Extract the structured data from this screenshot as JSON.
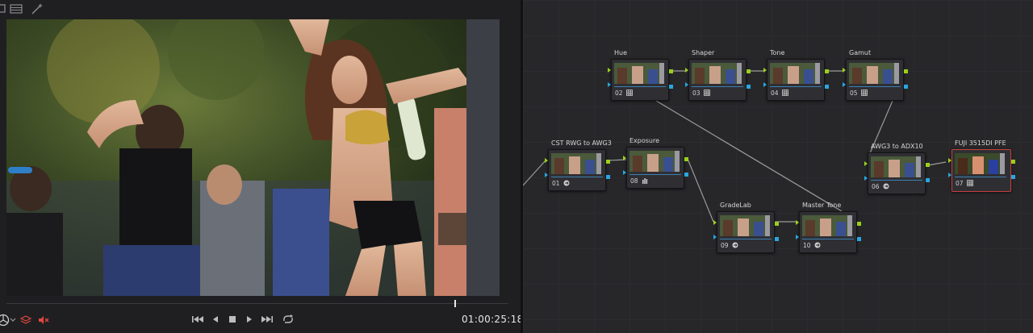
{
  "viewer": {
    "toolbar_icons": [
      "viewer-options-icon",
      "split-view-icon",
      "magic-wand-icon"
    ],
    "timecode": "01:00:25:18",
    "playhead_fraction": 0.893,
    "transport_icons": [
      "go-to-first-icon",
      "step-back-icon",
      "stop-icon",
      "play-icon",
      "go-to-last-icon",
      "loop-icon"
    ],
    "left_icons": [
      "color-wheel-icon",
      "layers-icon",
      "mute-icon"
    ],
    "accent_color": "#e0473f"
  },
  "nodes": [
    {
      "id": "hue",
      "label": "Hue",
      "num": "02",
      "icon": "grid-icon"
    },
    {
      "id": "shaper",
      "label": "Shaper",
      "num": "03",
      "icon": "grid-icon"
    },
    {
      "id": "tone",
      "label": "Tone",
      "num": "04",
      "icon": "grid-icon"
    },
    {
      "id": "gamut",
      "label": "Gamut",
      "num": "05",
      "icon": "grid-icon"
    },
    {
      "id": "cst",
      "label": "CST RWG to AWG3",
      "num": "01",
      "icon": "transform-icon"
    },
    {
      "id": "exposure",
      "label": "Exposure",
      "num": "08",
      "icon": "bars-icon"
    },
    {
      "id": "awg3",
      "label": "AWG3 to ADX10",
      "num": "06",
      "icon": "transform-icon"
    },
    {
      "id": "fuji",
      "label": "FUJI 3515DI PFE",
      "num": "07",
      "icon": "grid-icon"
    },
    {
      "id": "gradelab",
      "label": "GradeLab",
      "num": "09",
      "icon": "transform-icon"
    },
    {
      "id": "mastertone",
      "label": "Master Tone",
      "num": "10",
      "icon": "transform-icon"
    }
  ],
  "colors": {
    "rgb_pin": "#9bd01a",
    "alpha_pin": "#2aa6e0",
    "selected_node": "#c6403c"
  }
}
